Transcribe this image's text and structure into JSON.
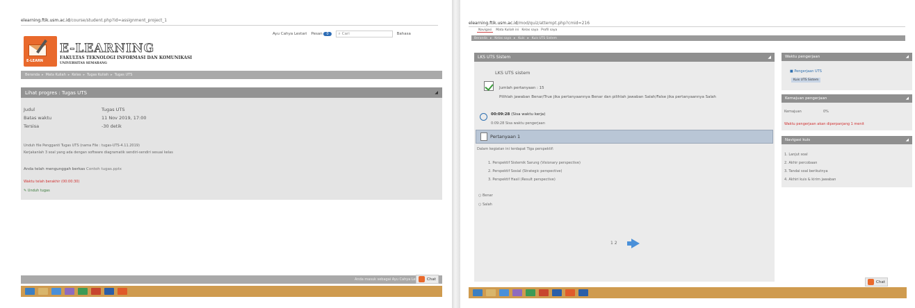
{
  "left": {
    "url": {
      "host": "elearning.ftik.usm.ac.id",
      "path": "/course/student.php?id=assignment_project_1"
    },
    "topright": {
      "user": "Ayu Cahya Lestari",
      "notif": "Pesan",
      "notif_count": "0",
      "search_placeholder": "Cari",
      "lang": "Bahasa"
    },
    "logo": {
      "badge": "E-LEARN",
      "title": "E-LEARNING",
      "faculty": "FAKULTAS TEKNOLOGI INFORMASI DAN KOMUNIKASI",
      "univ": "UNIVERSITAS SEMARANG"
    },
    "breadcrumb": [
      "Beranda",
      "Mata Kuliah",
      "Kelas",
      "Tugas Kuliah",
      "Tugas UTS"
    ],
    "panel": {
      "title": "Lihat progres : Tugas UTS",
      "rows": [
        {
          "label": "Judul",
          "value": "Tugas UTS"
        },
        {
          "label": "Batas waktu",
          "value": "11 Nov 2019, 17:00"
        },
        {
          "label": "Tersisa",
          "value": "-30 detik"
        }
      ],
      "desc1": "Unduh file Pengganti Tugas UTS (nama File : tugas-UTS-4.11.2019)",
      "desc2": "Kerjakanlah 3 soal yang ada dengan software diagramatik sendiri-sendiri sesuai kelas",
      "upload_label": "Anda telah mengunggah berkas",
      "upload_link": "Contoh tugas.pptx",
      "late": "Waktu telah berakhir (00:00:30)",
      "action": "Unduh tugas"
    },
    "footer_text": "Anda masuk sebagai Ayu Cahya Lestari",
    "chat": "Chat"
  },
  "right": {
    "url": {
      "host": "elearning.ftik.usm.ac.id",
      "path": "/mod/quiz/attempt.php?cmid=216"
    },
    "tabs": [
      "Navigasi",
      "Mata Kuliah ini",
      "Kelas saya",
      "Profil saya"
    ],
    "subnav": [
      "Beranda",
      "Kelas saya",
      "Kuis",
      "Kuis UTS Sistem"
    ],
    "quiz": {
      "title": "LKS UTS Sistem",
      "heading": "LKS UTS sistem",
      "count_label": "Jumlah pertanyaan : 15",
      "instruction": "Pilihlah jawaban Benar/True jika pertanyaannya Benar dan pilihlah jawaban Salah/False jika pertanyaannya Salah",
      "time": "00:09:28",
      "time_note": "(Sisa waktu kerja)",
      "timer_sub": "0:09:28 Sisa waktu pengerjaan",
      "question_label": "Pertanyaan 1",
      "question_text": "Dalam kegiatan ini terdapat Tiga perspektif:",
      "items": [
        "Perspektif Sistemik Sarung (Visionary perspective)",
        "Perspektif Sosial (Strategic perspective)",
        "Perspektif Hasil (Result perspective)"
      ],
      "options": [
        "Benar",
        "Salah"
      ],
      "pager": "1 2"
    },
    "side": {
      "nav_title": "Waktu pengerjaan",
      "nav_item": "Pengerjaan UTS",
      "nav_badge": "Kuis UTS Sistem",
      "progress_title": "Kemajuan pengerjaan",
      "progress_label": "Kemajuan",
      "progress_value": "0%",
      "progress_warning": "Waktu pengerjaan akan diperpanjang 1 menit",
      "links_title": "Navigasi kuis",
      "links": [
        "Lanjut soal",
        "Akhir percobaan",
        "Tandai soal berikutnya",
        "Akhiri kuis & kirim jawaban"
      ]
    },
    "chat": "Chat"
  }
}
